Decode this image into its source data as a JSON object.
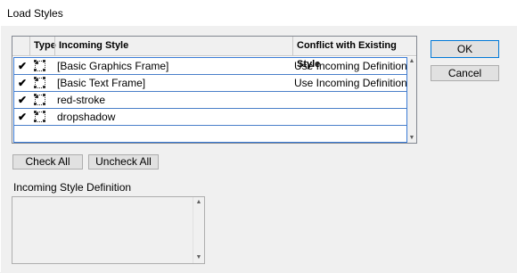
{
  "window": {
    "title": "Load Styles"
  },
  "table": {
    "headers": [
      "",
      "Type",
      "Incoming Style",
      "Conflict with Existing Style"
    ],
    "rows": [
      {
        "checked": "✔",
        "name": "[Basic Graphics Frame]",
        "conflict": "Use Incoming Definition"
      },
      {
        "checked": "✔",
        "name": "[Basic Text Frame]",
        "conflict": "Use Incoming Definition"
      },
      {
        "checked": "✔",
        "name": "red-stroke",
        "conflict": ""
      },
      {
        "checked": "✔",
        "name": "dropshadow",
        "conflict": ""
      }
    ],
    "type_icon": "object-style-icon",
    "scroll_up_glyph": "▲",
    "scroll_down_glyph": "▼"
  },
  "buttons": {
    "ok": "OK",
    "cancel": "Cancel",
    "check_all": "Check All",
    "uncheck_all": "Uncheck All"
  },
  "definition": {
    "label": "Incoming Style Definition",
    "text": ""
  },
  "colors": {
    "selection_border": "#3a7bd5",
    "default_button_border": "#0078d7"
  }
}
